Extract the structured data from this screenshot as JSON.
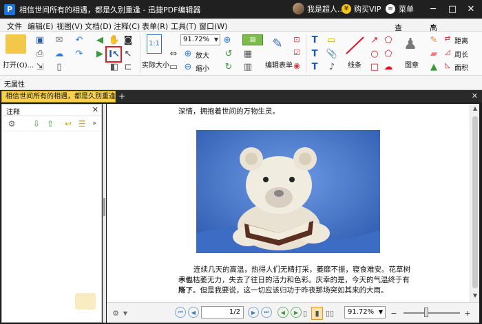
{
  "titlebar": {
    "title": "相信世间所有的相遇，都是久别重逢 - 迅捷PDF编辑器",
    "user_name": "我是超人...",
    "vip_label": "购买VIP",
    "menu_label": "菜单",
    "min": "─",
    "restore": "□",
    "close": "✕"
  },
  "menubar": {
    "items": [
      "文件",
      "编辑(E)",
      "视图(V)",
      "文档(D)",
      "注释(C)",
      "表单(R)",
      "工具(T)",
      "窗口(W)"
    ],
    "find_label": "查找(F)",
    "advanced_find_label": "高级查找(S)"
  },
  "ribbon": {
    "open_label": "打开(O)...",
    "zoom_value": "91.72%",
    "actual_size_label": "实际大小",
    "zoom_in_label": "放大",
    "zoom_out_label": "缩小",
    "edit_form_label": "编辑表单",
    "line_label": "线条",
    "stamp_label": "图章",
    "distance_label": "距离",
    "perimeter_label": "周长",
    "area_label": "面积"
  },
  "properties": {
    "label": "无属性"
  },
  "tabs": {
    "active": "相信世间所有的相遇，都是久别重逢 *"
  },
  "panel": {
    "title": "注释"
  },
  "document": {
    "line1": "深情，拥抱着世间的万物生灵。",
    "para2_line1": "连续几天的高温，热得人们无精打采，萎靡不振，寝食难安。花草树木似",
    "para2_line2": "乎也枯萎无力，失去了往日的活力和色彩。庆幸的是，今天的气温终于有所下",
    "para2_line3": "降了。但是我要说，这一切应该归功于昨夜那场突如其来的大雨。"
  },
  "status": {
    "page": "1/2",
    "zoom": "91.72%"
  },
  "colors": {
    "titlebar_bg": "#202020",
    "active_tab": "#f8d24f",
    "highlight_box": "#e0201f",
    "photo_bg": "#4f7fd0"
  }
}
